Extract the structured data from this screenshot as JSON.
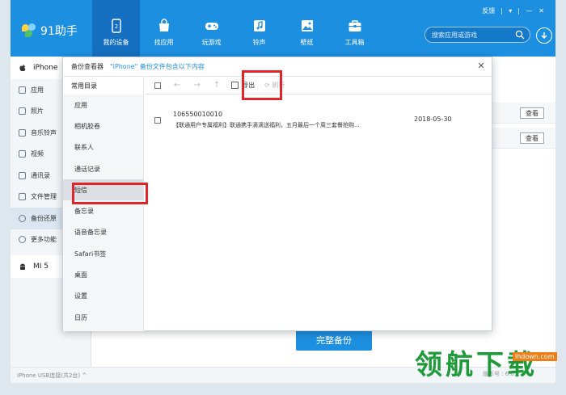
{
  "app": {
    "name": "91助手"
  },
  "nav": [
    {
      "label": "我的设备",
      "icon": "phone-icon",
      "active": true
    },
    {
      "label": "找应用",
      "icon": "bag-icon",
      "active": false
    },
    {
      "label": "玩游戏",
      "icon": "gamepad-icon",
      "active": false
    },
    {
      "label": "铃声",
      "icon": "music-note-icon",
      "active": false
    },
    {
      "label": "壁纸",
      "icon": "image-icon",
      "active": false
    },
    {
      "label": "工具箱",
      "icon": "toolbox-icon",
      "active": false
    }
  ],
  "window_controls": {
    "feedback": "反馈",
    "menu": "▾",
    "minimize": "—",
    "close": "✕"
  },
  "search": {
    "placeholder": "搜索应用或游戏"
  },
  "sidebar": {
    "device": "iPhone",
    "items": [
      {
        "label": "应用",
        "icon": "apps-icon"
      },
      {
        "label": "照片",
        "icon": "camera-icon"
      },
      {
        "label": "音乐铃声",
        "icon": "music-icon"
      },
      {
        "label": "视频",
        "icon": "video-icon"
      },
      {
        "label": "通讯录",
        "icon": "contacts-icon"
      },
      {
        "label": "文件管理",
        "icon": "folder-icon"
      },
      {
        "label": "备份还原",
        "icon": "sync-icon",
        "active": true
      },
      {
        "label": "更多功能",
        "icon": "more-icon"
      }
    ],
    "second_device": "MI 5"
  },
  "status_bar": {
    "text": "iPhone  USB连接(共2台) ^"
  },
  "background": {
    "view_buttons": [
      "查看",
      "查看"
    ],
    "full_backup_label": "完整备份",
    "version_text": "版本号 : 6.0..."
  },
  "dialog": {
    "title": "备份查看器",
    "title_quote": "\"iPhone\" 备份文件包含以下内容",
    "close": "✕",
    "categories_header": "常用目录",
    "categories": [
      {
        "label": "应用"
      },
      {
        "label": "相机胶卷"
      },
      {
        "label": "联系人"
      },
      {
        "label": "通话记录"
      },
      {
        "label": "短信",
        "active": true
      },
      {
        "label": "备忘录"
      },
      {
        "label": "语音备忘录"
      },
      {
        "label": "Safari书签"
      },
      {
        "label": "桌面"
      },
      {
        "label": "设置"
      },
      {
        "label": "日历"
      }
    ],
    "toolbar": {
      "back": "←",
      "forward": "→",
      "up": "↑",
      "export_label": "导出",
      "refresh_label": "刷新"
    },
    "messages": [
      {
        "sender": "106550010010",
        "body": "【联通用户专属福利】联通携手滴滴送福利，五月最后一个周三套餐抢购...",
        "date": "2018-05-30"
      }
    ]
  },
  "watermark": {
    "text": "领航下载",
    "url": "lhdown.com"
  },
  "colors": {
    "primary": "#1d8fe1",
    "active_nav": "#156fc0",
    "highlight": "#e0262b",
    "watermark": "#1f9a3a"
  }
}
